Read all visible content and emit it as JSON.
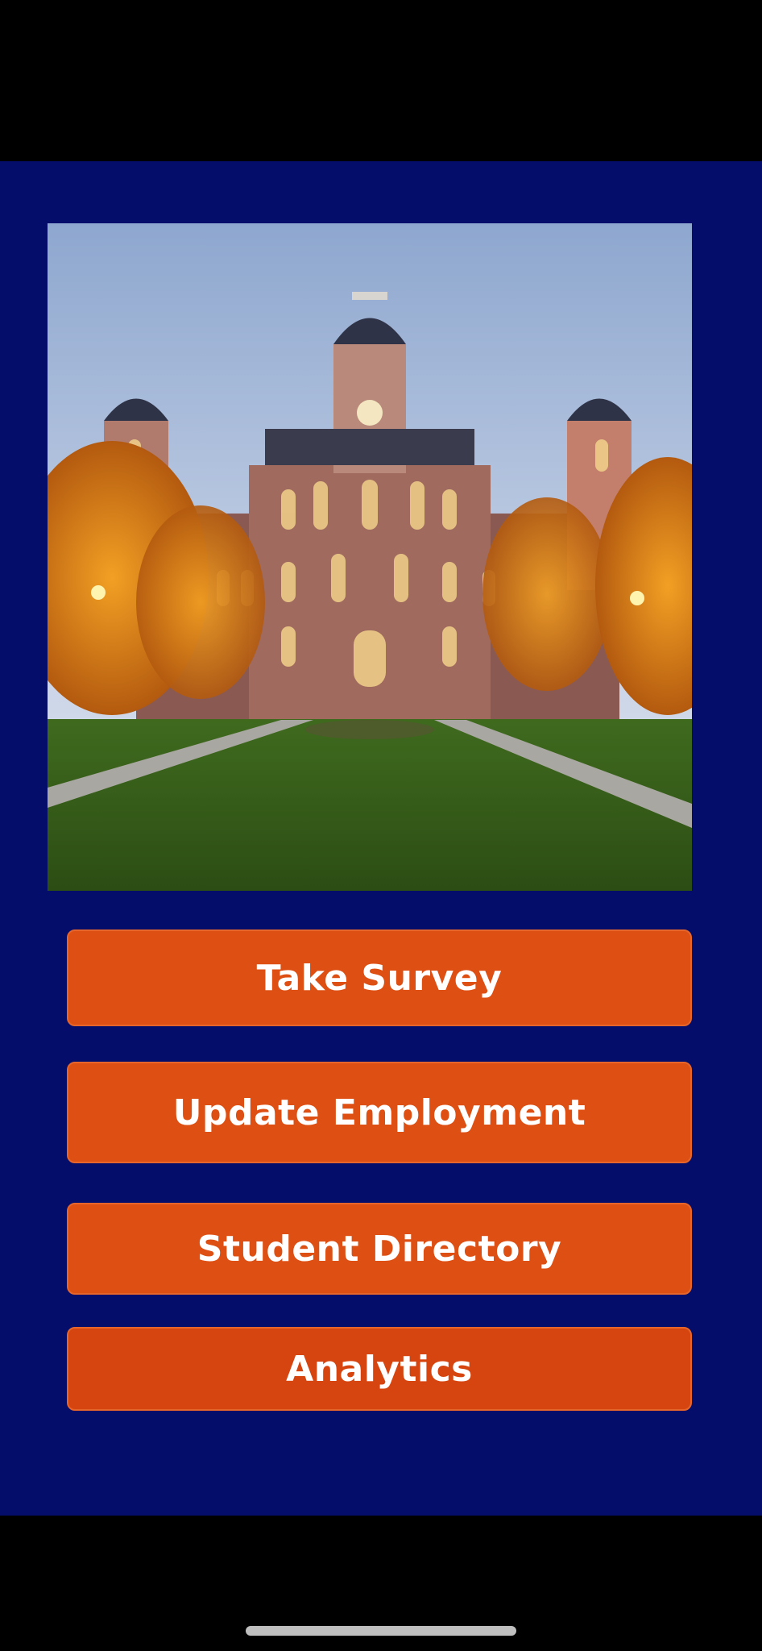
{
  "hero": {
    "image_alt": "campus-building-photo"
  },
  "buttons": {
    "take_survey": "Take Survey",
    "update_employment": "Update Employment",
    "student_directory": "Student Directory",
    "analytics": "Analytics"
  },
  "colors": {
    "background": "#050d6b",
    "button": "#dd4f13",
    "button_text": "#ffffff"
  }
}
